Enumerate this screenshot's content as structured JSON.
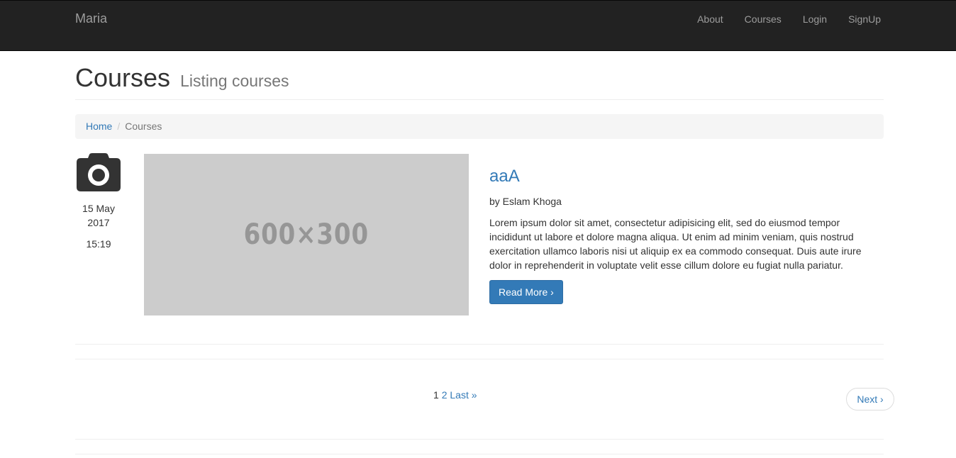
{
  "navbar": {
    "brand": "Maria",
    "links": [
      "About",
      "Courses",
      "Login",
      "SignUp"
    ]
  },
  "header": {
    "title": "Courses",
    "subtitle": "Listing courses"
  },
  "breadcrumb": {
    "home": "Home",
    "separator": "/",
    "current": "Courses"
  },
  "course": {
    "date_day_month": "15 May",
    "date_year": "2017",
    "time": "15:19",
    "thumbnail_text": "600×300",
    "title": "aaA",
    "author": "by Eslam Khoga",
    "description": "Lorem ipsum dolor sit amet, consectetur adipisicing elit, sed do eiusmod tempor incididunt ut labore et dolore magna aliqua. Ut enim ad minim veniam, quis nostrud exercitation ullamco laboris nisi ut aliquip ex ea commodo consequat. Duis aute irure dolor in reprehenderit in voluptate velit esse cillum dolore eu fugiat nulla pariatur.",
    "read_more": "Read More ›"
  },
  "pagination": {
    "current": "1",
    "page2": "2",
    "last": "Last »",
    "next": "Next ›"
  },
  "icons": {
    "date": "camera-icon"
  },
  "colors": {
    "navbar_bg": "#222222",
    "link": "#337ab7",
    "button": "#337ab7",
    "thumbnail_bg": "#cccccc"
  }
}
